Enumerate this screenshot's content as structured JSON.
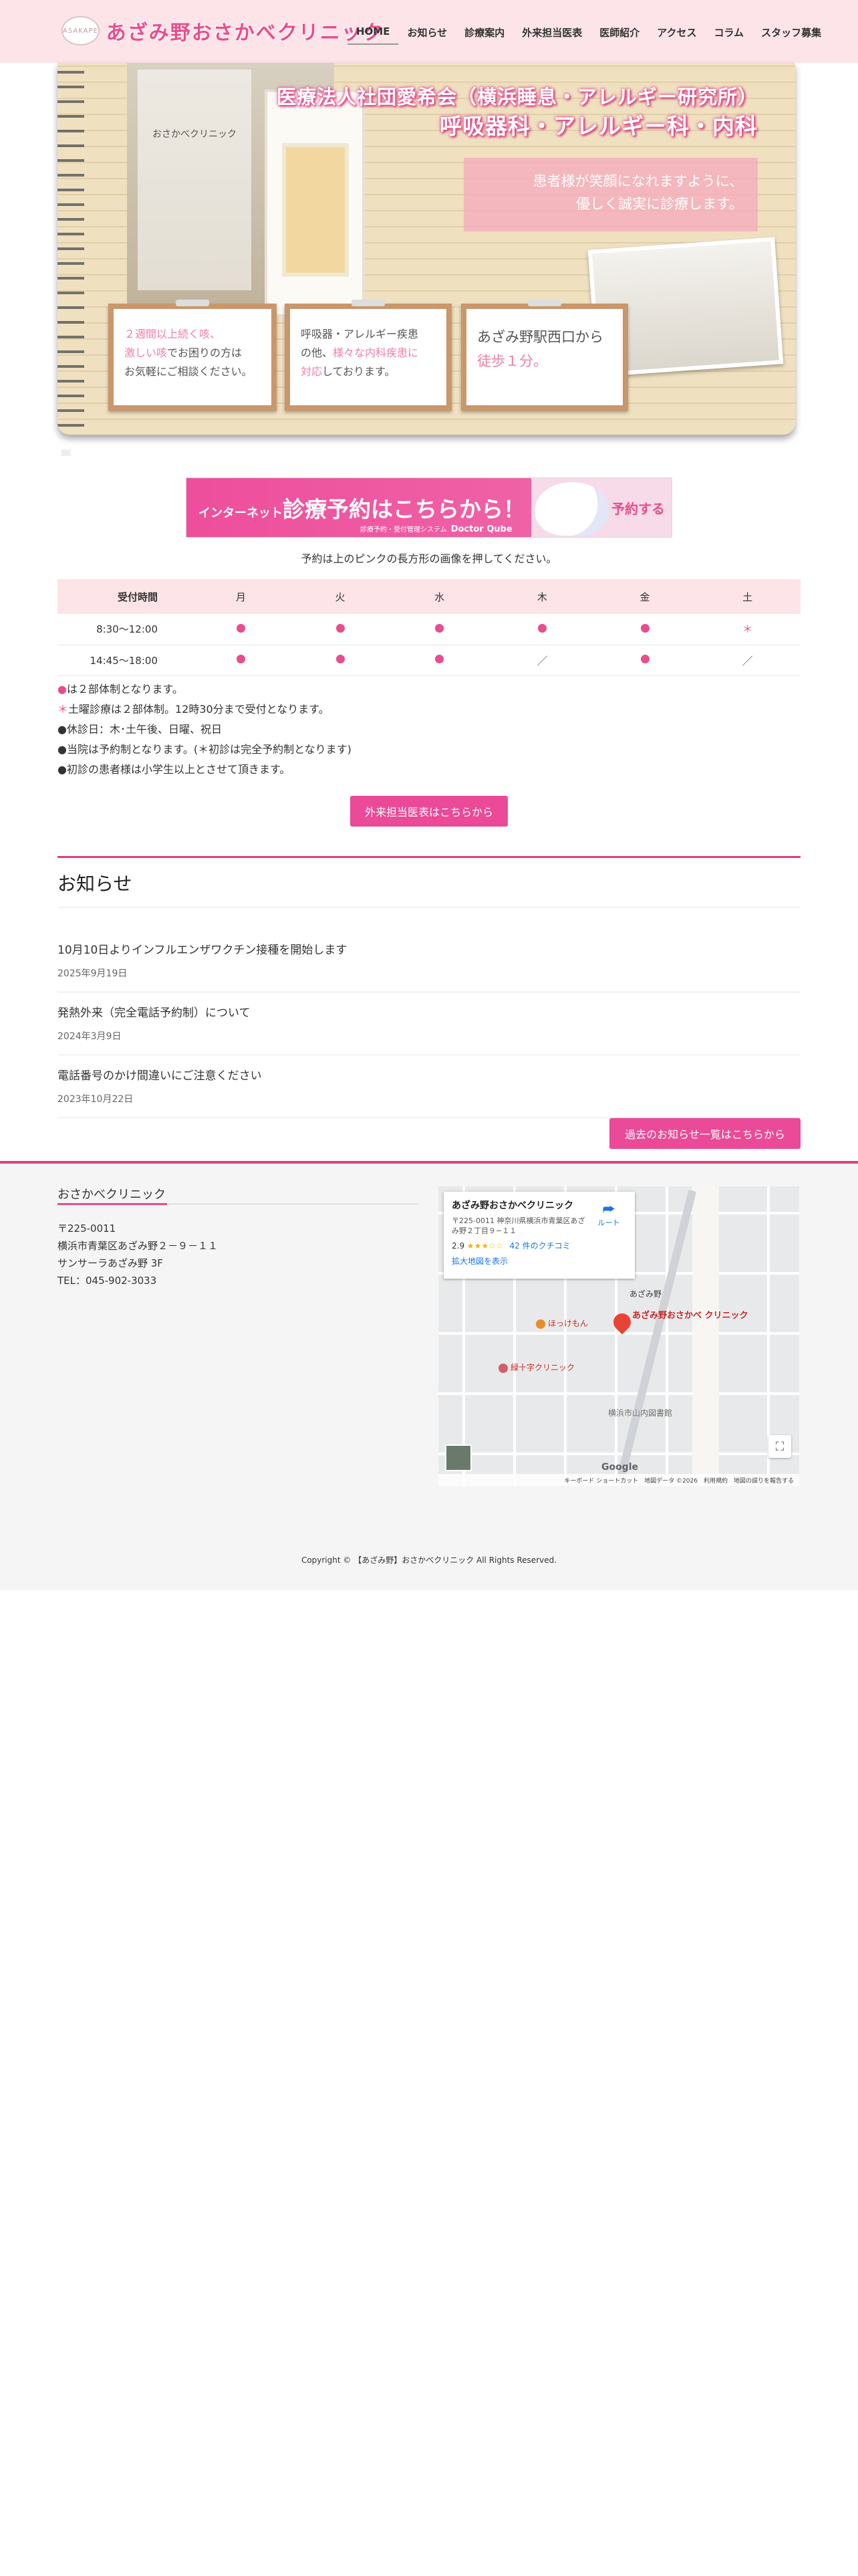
{
  "header": {
    "logo_mark": "ASAKAPE",
    "logo_text": "あざみ野おさかべクリニック",
    "nav": [
      {
        "label": "HOME",
        "active": true
      },
      {
        "label": "お知らせ"
      },
      {
        "label": "診療案内"
      },
      {
        "label": "外来担当医表"
      },
      {
        "label": "医師紹介"
      },
      {
        "label": "アクセス"
      },
      {
        "label": "コラム"
      },
      {
        "label": "スタッフ募集"
      }
    ]
  },
  "hero": {
    "title_line1": "医療法人社団愛希会（横浜睡息・アレルギー研究所）",
    "title_line2": "呼吸器科・アレルギー科・内科",
    "message_line1": "患者様が笑顔になれますように、",
    "message_line2": "優しく誠実に診療します。",
    "sign_text": "おさかべクリニック",
    "cards": [
      {
        "parts": [
          {
            "text": "２週間以上続く咳、",
            "pink": true
          },
          {
            "text": "激しい咳",
            "pink": true
          },
          {
            "text": "でお困りの方は",
            "pink": false
          },
          {
            "text": "お気軽にご相談ください。",
            "pink": false
          }
        ]
      },
      {
        "parts": [
          {
            "text": "呼吸器・アレルギー疾患",
            "pink": false
          },
          {
            "text": "の他、",
            "pink": false
          },
          {
            "text": "様々な内科疾患に",
            "pink": true
          },
          {
            "text": "対応",
            "pink": true
          },
          {
            "text": "しております。",
            "pink": false
          }
        ]
      },
      {
        "parts": [
          {
            "text": "あざみ野駅西口から",
            "pink": false
          },
          {
            "text": "徒歩１分。",
            "pink": true
          }
        ]
      }
    ]
  },
  "banner": {
    "prefix": "インターネット",
    "main": "診療予約はこちらから！",
    "system_label": "診療予約・受付管理システム",
    "system_name": "Doctor Qube",
    "cta": "予約する"
  },
  "reserve_note": "予約は上のピンクの長方形の画像を押してください。",
  "schedule": {
    "header": [
      "受付時間",
      "月",
      "火",
      "水",
      "木",
      "金",
      "土"
    ],
    "rows": [
      {
        "time": "8:30〜12:00",
        "cells": [
          "dot",
          "dot",
          "dot",
          "dot",
          "dot",
          "star"
        ]
      },
      {
        "time": "14:45〜18:00",
        "cells": [
          "dot",
          "dot",
          "dot",
          "slash",
          "dot",
          "slash"
        ]
      }
    ],
    "symbols": {
      "star": "＊",
      "slash": "／"
    }
  },
  "notes": [
    {
      "marker": "●",
      "marker_pink": true,
      "text": "は２部体制となります。"
    },
    {
      "marker": "＊",
      "marker_pink": true,
      "text": "土曜診療は２部体制。12時30分まで受付となります。"
    },
    {
      "marker": "●",
      "marker_pink": false,
      "text": "休診日：木･土午後、日曜、祝日"
    },
    {
      "marker": "●",
      "marker_pink": false,
      "text": "当院は予約制となります。(＊初診は完全予約制となります)"
    },
    {
      "marker": "●",
      "marker_pink": false,
      "text": "初診の患者様は小学生以上とさせて頂きます。"
    }
  ],
  "schedule_button": "外来担当医表はこちらから",
  "news": {
    "title": "お知らせ",
    "items": [
      {
        "title": "10月10日よりインフルエンザワクチン接種を開始します",
        "date": "2025年9月19日"
      },
      {
        "title": "発熱外来（完全電話予約制）について",
        "date": "2024年3月9日"
      },
      {
        "title": "電話番号のかけ間違いにご注意ください",
        "date": "2023年10月22日"
      }
    ],
    "more_button": "過去のお知らせ一覧はこちらから"
  },
  "footer": {
    "clinic_name": "おさかべクリニック",
    "address_lines": [
      "〒225-0011",
      "横浜市青葉区あざみ野２－９－１１",
      "サンサーラあざみ野 3F",
      "TEL：045-902-3033"
    ],
    "copyright": "Copyright © 【あざみ野】おさかべクリニック All Rights Reserved."
  },
  "map": {
    "place_name": "あざみ野おさかべクリニック",
    "address": "〒225-0011 神奈川県横浜市青葉区あざみ野２丁目９−１１",
    "rating": "2.9",
    "stars": "★★★☆☆",
    "reviews": "42 件のクチコミ",
    "enlarge": "拡大地図を表示",
    "route_label": "ルート",
    "pin_label": "あざみ野おさかべ クリニック",
    "pois": [
      "ほっけもん",
      "緑十字クリニック",
      "あざみ野",
      "横浜市山内図書館"
    ],
    "attribution": "キーボード ショートカット　地図データ ©2026　利用規約　地図の誤りを報告する",
    "google": "Google"
  }
}
